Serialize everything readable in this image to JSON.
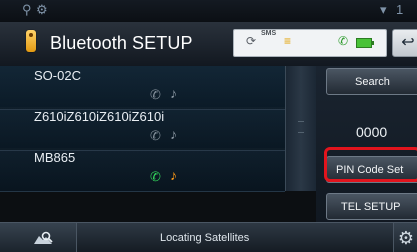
{
  "header": {
    "title": "Bluetooth SETUP",
    "icons": {
      "top_left": [
        "signal-icon",
        "gps-icon"
      ],
      "top_right": [
        "wifi-signal-icon",
        "number-icon"
      ],
      "title": "bluetooth-device-icon",
      "status": [
        "sync-icon",
        "sms-icon",
        "signal-strength-icon",
        "phone-icon",
        "battery-icon"
      ],
      "back": "return-icon"
    },
    "top_right_text": "1",
    "sms_label": "SMS"
  },
  "device_list": {
    "items": [
      {
        "name": "SO-02C",
        "connected": false
      },
      {
        "name": "Z610iZ610iZ610iZ610i",
        "connected": false
      },
      {
        "name": "MB865",
        "connected": true
      }
    ],
    "service_icons": [
      "phone-icon",
      "music-note-icon"
    ],
    "scrollbar_grip": "="
  },
  "right_panel": {
    "search_label": "Search",
    "pin_code": "0000",
    "pin_code_set_label": "PIN Code Set",
    "tel_setup_label": "TEL SETUP"
  },
  "bottom_bar": {
    "status_message": "Locating Satellites",
    "left_icon": "map-search-icon",
    "right_icon": "gear-icon"
  },
  "colors": {
    "highlight": "#e2141d",
    "phone_connected": "#32d15a",
    "audio_connected": "#ff9a16"
  }
}
